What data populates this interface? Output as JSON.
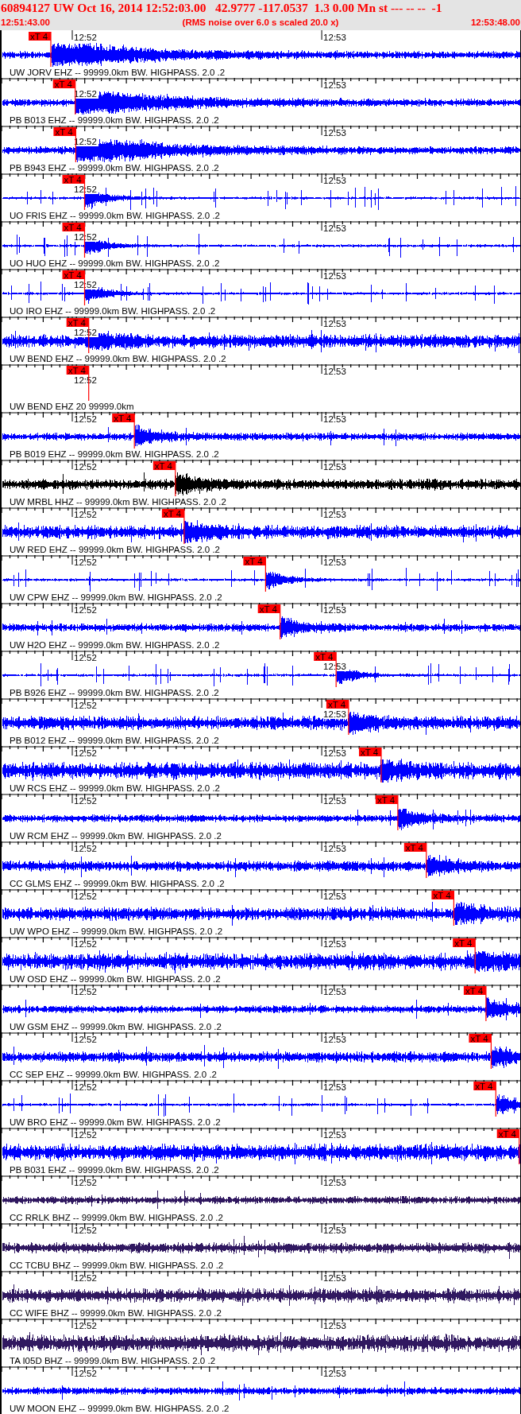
{
  "header": {
    "title": "60894127 UW Oct 16, 2014 12:52:03.00   42.9777 -117.0537  1.3 0.00 Mn st --- -- --  -1",
    "start_time": "12:51:43.00",
    "note": "(RMS noise over 6.0 s scaled 20.0 x)",
    "end_time": "12:53:48.00"
  },
  "traces": [
    {
      "label": "UW JORV EHZ -- 99999.0km BW. HIGHPASS. 2.0 .2",
      "kind": "event",
      "color": "#0000ff",
      "time_labels": [
        "12:52",
        "12:53"
      ],
      "pick": {
        "label": "xT 4",
        "level": 0.095
      }
    },
    {
      "label": "PB B013 EHZ -- 99999.0km BW. HIGHPASS. 2.0 .2",
      "kind": "event",
      "color": "#0000ff",
      "time_labels": [
        "12:52",
        "12:53"
      ],
      "pick": {
        "label": "xT 4",
        "level": 0.142
      }
    },
    {
      "label": "PB B943 EHZ -- 99999.0km BW. HIGHPASS. 2.0 .2",
      "kind": "event",
      "color": "#0000ff",
      "time_labels": [
        "12:52",
        "12:53"
      ],
      "pick": {
        "label": "xT 4",
        "level": 0.143
      }
    },
    {
      "label": "UO FRIS EHZ -- 99999.0km BW. HIGHPASS. 2.0 .2",
      "kind": "spiky",
      "color": "#0000ff",
      "time_labels": [
        "12:52",
        "12:53"
      ],
      "pick": {
        "label": "xT 4",
        "level": 0.16
      }
    },
    {
      "label": "UO HUO EHZ -- 99999.0km BW. HIGHPASS. 2.0 .2",
      "kind": "spiky",
      "color": "#0000ff",
      "time_labels": [
        "12:52",
        "12:53"
      ],
      "pick": {
        "label": "xT 4",
        "level": 0.16
      }
    },
    {
      "label": "UO IRO EHZ -- 99999.0km BW. HIGHPASS. 2.0 .2",
      "kind": "spiky",
      "color": "#0000ff",
      "time_labels": [
        "12:52",
        "12:53"
      ],
      "pick": {
        "label": "xT 4",
        "level": 0.16
      }
    },
    {
      "label": "UW BEND EHZ -- 99999.0km BW. HIGHPASS. 2.0 .2",
      "kind": "noise",
      "color": "#0000ff",
      "time_labels": [
        "12:52",
        "12:53"
      ],
      "pick": {
        "label": "xT 4",
        "level": 0.168
      }
    },
    {
      "label": "UW BEND EHZ 20 99999.0km",
      "kind": "flat",
      "time_labels": [
        "12:52",
        "12:53"
      ],
      "pick": {
        "label": "xT 4",
        "level": 0.168
      }
    },
    {
      "label": "PB B019 EHZ -- 99999.0km BW. HIGHPASS. 2.0 .2",
      "kind": "noise",
      "color": "#0000ff",
      "time_labels": [
        "12:52",
        "12:53"
      ],
      "pick": {
        "label": "xT 4",
        "level": 0.256
      }
    },
    {
      "label": "UW MRBL HHZ -- 99999.0km BW. HIGHPASS. 2.0 .2",
      "kind": "noise",
      "color": "#000000",
      "time_labels": [
        "12:52",
        "12:53"
      ],
      "pick": {
        "label": "xT 4",
        "level": 0.335
      }
    },
    {
      "label": "UW RED EHZ -- 99999.0km BW. HIGHPASS. 2.0 .2",
      "kind": "noise",
      "color": "#0000ff",
      "time_labels": [
        "12:52",
        "12:53"
      ],
      "pick": {
        "label": "xT 4",
        "level": 0.352
      }
    },
    {
      "label": "UW CPW EHZ -- 99999.0km BW. HIGHPASS. 2.0 .2",
      "kind": "spiky",
      "color": "#0000ff",
      "time_labels": [
        "12:52",
        "12:53"
      ],
      "pick": {
        "label": "xT 4",
        "level": 0.509
      }
    },
    {
      "label": "UW H2O EHZ -- 99999.0km BW. HIGHPASS. 2.0 .2",
      "kind": "noise",
      "color": "#0000ff",
      "time_labels": [
        "12:52",
        "12:53"
      ],
      "pick": {
        "label": "xT 4",
        "level": 0.537
      }
    },
    {
      "label": "PB B926 EHZ -- 99999.0km BW. HIGHPASS. 2.0 .2",
      "kind": "spiky",
      "color": "#0000ff",
      "time_labels": [
        "12:52",
        "12:53"
      ],
      "pick": {
        "label": "xT 4",
        "level": 0.645
      }
    },
    {
      "label": "PB B012 EHZ -- 99999.0km BW. HIGHPASS. 2.0 .2",
      "kind": "noise",
      "color": "#0000ff",
      "time_labels": [
        "12:52",
        "12:53"
      ],
      "pick": {
        "label": "xT 4",
        "level": 0.669
      }
    },
    {
      "label": "UW RCS EHZ -- 99999.0km BW. HIGHPASS. 2.0 .2",
      "kind": "noise",
      "color": "#0000ff",
      "time_labels": [
        "12:52",
        "12:53"
      ],
      "pick": {
        "label": "xT 4",
        "level": 0.732
      }
    },
    {
      "label": "UW RCM EHZ -- 99999.0km BW. HIGHPASS. 2.0 .2",
      "kind": "noise",
      "color": "#0000ff",
      "time_labels": [
        "12:52",
        "12:53"
      ],
      "pick": {
        "label": "xT 4",
        "level": 0.764
      }
    },
    {
      "label": "CC GLMS EHZ -- 99999.0km BW. HIGHPASS. 2.0 .2",
      "kind": "noise",
      "color": "#0000ff",
      "time_labels": [
        "12:52",
        "12:53"
      ],
      "pick": {
        "label": "xT 4",
        "level": 0.819
      }
    },
    {
      "label": "UW WPO EHZ -- 99999.0km BW. HIGHPASS. 2.0 .2",
      "kind": "noise",
      "color": "#0000ff",
      "time_labels": [
        "12:52",
        "12:53"
      ],
      "pick": {
        "label": "xT 4",
        "level": 0.872
      }
    },
    {
      "label": "UW OSD EHZ -- 99999.0km BW. HIGHPASS. 2.0 .2",
      "kind": "noise",
      "color": "#0000ff",
      "time_labels": [
        "12:52",
        "12:53"
      ],
      "pick": {
        "label": "xT 4",
        "level": 0.913
      }
    },
    {
      "label": "UW GSM EHZ -- 99999.0km BW. HIGHPASS. 2.0 .2",
      "kind": "noise",
      "color": "#0000ff",
      "time_labels": [
        "12:52",
        "12:53"
      ],
      "pick": {
        "label": "xT 4",
        "level": 0.934
      }
    },
    {
      "label": "CC SEP EHZ -- 99999.0km BW. HIGHPASS. 2.0 .2",
      "kind": "noise",
      "color": "#0000ff",
      "time_labels": [
        "12:52",
        "12:53"
      ],
      "pick": {
        "label": "xT 4",
        "level": 0.944
      }
    },
    {
      "label": "UW BRO EHZ -- 99999.0km BW. HIGHPASS. 2.0 .2",
      "kind": "spiky",
      "color": "#0000ff",
      "time_labels": [
        "12:52",
        "12:53"
      ],
      "pick": {
        "label": "xT 4",
        "level": 0.953
      }
    },
    {
      "label": "PB B031 EHZ -- 99999.0km BW. HIGHPASS. 2.0 .2",
      "kind": "noise",
      "color": "#0000ff",
      "time_labels": [
        "12:52",
        "12:53"
      ],
      "pick": {
        "label": "xT 4",
        "level": 0.998
      }
    },
    {
      "label": "CC RRLK BHZ -- 99999.0km BW. HIGHPASS. 2.0 .2",
      "kind": "noise",
      "color": "#301860",
      "time_labels": [
        "12:52",
        "12:53"
      ]
    },
    {
      "label": "CC TCBU BHZ -- 99999.0km BW. HIGHPASS. 2.0 .2",
      "kind": "noise",
      "color": "#301860",
      "time_labels": [
        "12:52",
        "12:53"
      ]
    },
    {
      "label": "CC WIFE BHZ -- 99999.0km BW. HIGHPASS. 2.0 .2",
      "kind": "noise",
      "color": "#301860",
      "time_labels": [
        "12:52",
        "12:53"
      ]
    },
    {
      "label": "TA I05D BHZ -- 99999.0km BW. HIGHPASS. 2.0 .2",
      "kind": "noise",
      "color": "#301860",
      "time_labels": [
        "12:52",
        "12:53"
      ]
    },
    {
      "label": "UW MOON EHZ -- 99999.0km BW. HIGHPASS. 2.0 .2",
      "kind": "noise",
      "color": "#0000ff",
      "time_labels": [
        "12:52",
        "12:53"
      ]
    }
  ]
}
